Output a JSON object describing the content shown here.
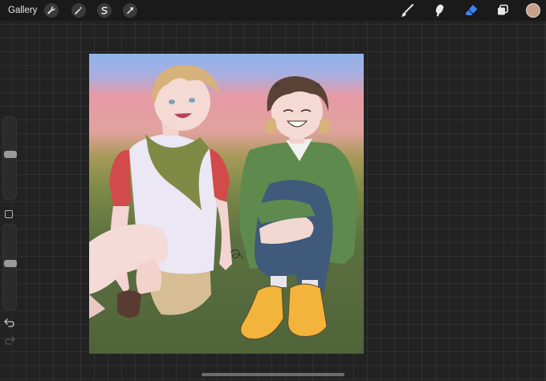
{
  "topbar": {
    "gallery_label": "Gallery",
    "left_tools": [
      {
        "icon": "wrench-icon",
        "name": "actions-button"
      },
      {
        "icon": "magic-wand-icon",
        "name": "adjustments-button"
      },
      {
        "icon": "selection-s-icon",
        "name": "selection-button"
      },
      {
        "icon": "arrow-cursor-icon",
        "name": "transform-button"
      }
    ],
    "right_tools": [
      {
        "icon": "brush-icon",
        "name": "brush-tool-button"
      },
      {
        "icon": "smudge-icon",
        "name": "smudge-tool-button"
      },
      {
        "icon": "eraser-icon",
        "name": "eraser-tool-button",
        "active": true
      },
      {
        "icon": "layers-icon",
        "name": "layers-button"
      }
    ],
    "current_color": "#c9a088",
    "active_tool_color": "#3b82f6"
  },
  "sidebar": {
    "brush_size_level": 0.45,
    "opacity_level": 0.45,
    "undo_icon": "undo-icon",
    "redo_icon": "redo-icon"
  },
  "artwork": {
    "colors": {
      "sky": "#8fb4ea",
      "sunset_pink": "#e69aa6",
      "grass": "#556b3d",
      "green_jacket": "#5e8a4e",
      "jeans": "#3f5a7a",
      "shoes": "#f2b43a",
      "red_sleeve": "#d24a4a",
      "scarf": "#7f8a45",
      "hair_blond": "#d7b27a",
      "hair_brown": "#5a4236"
    }
  }
}
